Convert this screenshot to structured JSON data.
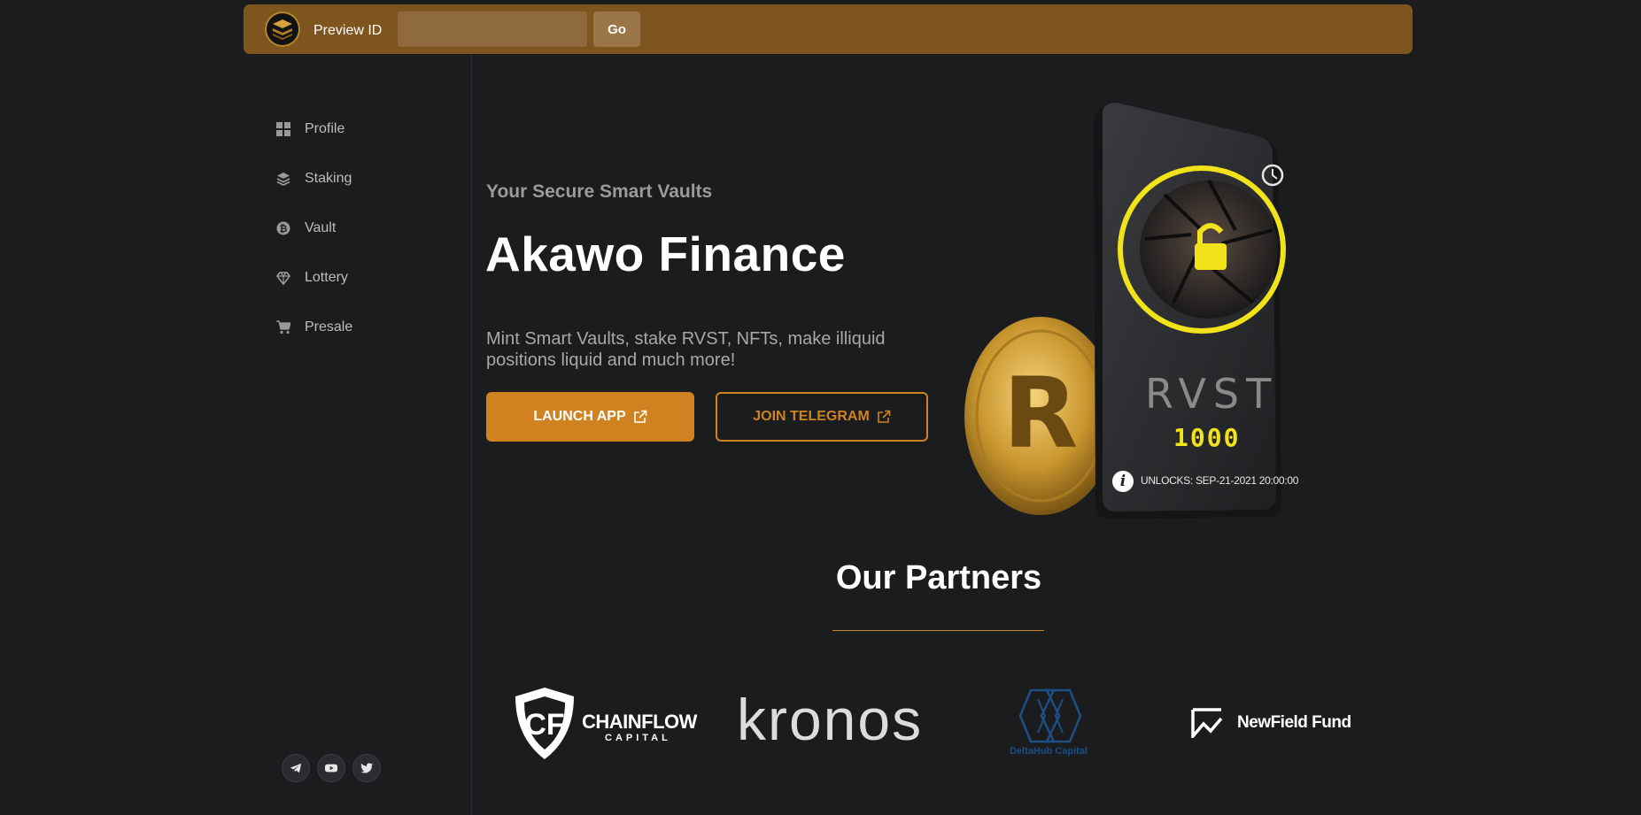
{
  "topbar": {
    "preview_label": "Preview ID",
    "preview_input_value": "",
    "go_label": "Go"
  },
  "sidebar": {
    "items": [
      {
        "label": "Profile",
        "icon": "grid-icon"
      },
      {
        "label": "Staking",
        "icon": "layers-icon"
      },
      {
        "label": "Vault",
        "icon": "bitcoin-icon"
      },
      {
        "label": "Lottery",
        "icon": "diamond-icon"
      },
      {
        "label": "Presale",
        "icon": "cart-icon"
      }
    ],
    "socials": [
      "telegram-icon",
      "youtube-icon",
      "twitter-icon"
    ]
  },
  "hero": {
    "tagline": "Your Secure Smart Vaults",
    "title": "Akawo Finance",
    "description": "Mint Smart Vaults, stake RVST, NFTs, make illiquid positions liquid and much more!",
    "launch_label": "LAUNCH APP",
    "telegram_label": "JOIN TELEGRAM",
    "vault_card": {
      "token": "RVST",
      "amount": "1000",
      "unlocks": "UNLOCKS: SEP-21-2021 20:00:00"
    }
  },
  "partners": {
    "title": "Our Partners",
    "logos": [
      {
        "name": "CHAINFLOW",
        "sub": "CAPITAL"
      },
      {
        "name": "kronos"
      },
      {
        "name": "DeltaHub Capital"
      },
      {
        "name": "NewField Fund"
      }
    ]
  },
  "colors": {
    "accent": "#cf821f",
    "topbar": "#7e541f",
    "background": "#1b1c1e"
  }
}
